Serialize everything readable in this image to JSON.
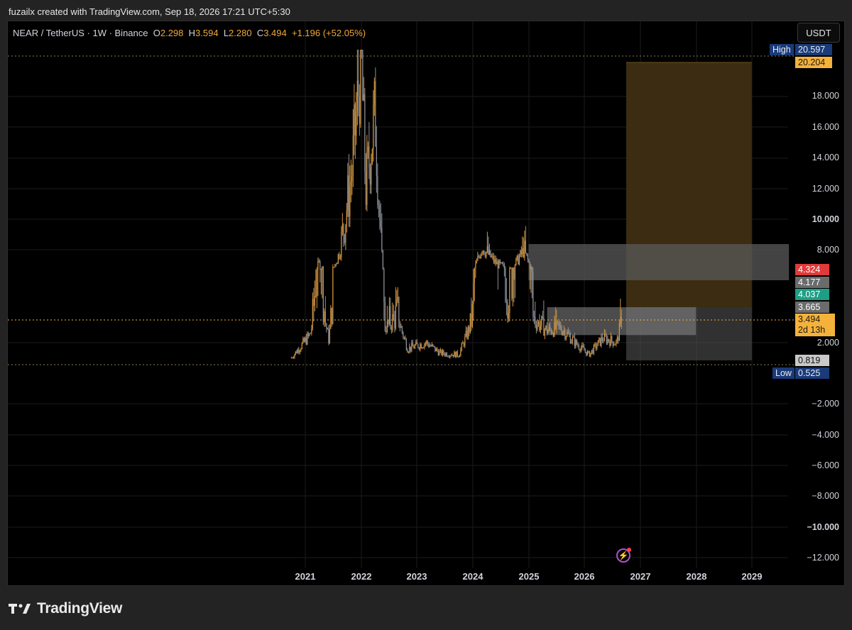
{
  "header": {
    "text": "fuzailx created with TradingView.com, Sep 18, 2026 17:21 UTC+5:30"
  },
  "legend": {
    "symbol": "NEAR / TetherUS · 1W · Binance",
    "open_label": "O",
    "open": "2.298",
    "high_label": "H",
    "high": "3.594",
    "low_label": "L",
    "low": "2.280",
    "close_label": "C",
    "close": "3.494",
    "change": "+1.196 (+52.05%)"
  },
  "currency_button": "USDT",
  "price_tags": {
    "high_label": "High",
    "high_value": "20.597",
    "target": "20.204",
    "t1": "4.324",
    "t2": "4.177",
    "t3": "4.037",
    "t4": "3.665",
    "last": "3.494",
    "countdown": "2d 13h",
    "t5": "0.819",
    "low_label": "Low",
    "low_value": "0.525"
  },
  "colors": {
    "background": "#000000",
    "candle": "#d4953a",
    "candle_alt": "#8c8f98",
    "target_zone": "#3b2c12",
    "grey_zone": "#5a5a5a",
    "accent_yellow": "#f5b23a",
    "tag_blue": "#1a3a78",
    "tag_red": "#e03a3a",
    "tag_green": "#1f9e85",
    "tag_grey": "#6b6b6b"
  },
  "chart_data": {
    "type": "candlestick",
    "title": "NEAR / TetherUS · 1W · Binance",
    "x_ticks": [
      "2021",
      "2022",
      "2023",
      "2024",
      "2025",
      "2026",
      "2027",
      "2028",
      "2029"
    ],
    "y_ticks": [
      "18.000",
      "16.000",
      "14.000",
      "12.000",
      "10.000",
      "8.000",
      "2.000",
      "−2.000",
      "−4.000",
      "−6.000",
      "−8.000",
      "−10.000",
      "−12.000"
    ],
    "y_scale": "log-style price axis",
    "grid": true,
    "approx_close_path": [
      {
        "x": "2020-10",
        "y": 1.0
      },
      {
        "x": "2021-02",
        "y": 2.5
      },
      {
        "x": "2021-04",
        "y": 5.5
      },
      {
        "x": "2021-06",
        "y": 2.2
      },
      {
        "x": "2021-09",
        "y": 9.0
      },
      {
        "x": "2021-11",
        "y": 13.0
      },
      {
        "x": "2022-01",
        "y": 20.5
      },
      {
        "x": "2022-02",
        "y": 12.0
      },
      {
        "x": "2022-04",
        "y": 17.0
      },
      {
        "x": "2022-06",
        "y": 3.0
      },
      {
        "x": "2022-09",
        "y": 3.5
      },
      {
        "x": "2022-11",
        "y": 1.6
      },
      {
        "x": "2023-03",
        "y": 2.0
      },
      {
        "x": "2023-06",
        "y": 1.3
      },
      {
        "x": "2023-10",
        "y": 1.2
      },
      {
        "x": "2024-01",
        "y": 3.5
      },
      {
        "x": "2024-03",
        "y": 8.5
      },
      {
        "x": "2024-06",
        "y": 5.5
      },
      {
        "x": "2024-09",
        "y": 4.0
      },
      {
        "x": "2024-12",
        "y": 7.8
      },
      {
        "x": "2025-02",
        "y": 3.5
      },
      {
        "x": "2025-05",
        "y": 2.8
      },
      {
        "x": "2025-08",
        "y": 3.0
      },
      {
        "x": "2025-11",
        "y": 2.0
      },
      {
        "x": "2026-02",
        "y": 1.2
      },
      {
        "x": "2026-05",
        "y": 2.3
      },
      {
        "x": "2026-08",
        "y": 2.0
      },
      {
        "x": "2026-09",
        "y": 3.494
      }
    ],
    "zones": [
      {
        "name": "target",
        "from_price": 3.665,
        "to_price": 20.204,
        "from_date": "2026-10",
        "to_date": "2029-01"
      },
      {
        "name": "upper-grey",
        "from_price": 4.324,
        "to_price": 8.4,
        "from_date": "2025-01",
        "to_date": "2029-09"
      },
      {
        "name": "lower-grey",
        "from_price": 0.819,
        "to_price": 3.665,
        "from_date": "2026-10",
        "to_date": "2029-01"
      },
      {
        "name": "mid-grey",
        "from_price": 2.5,
        "to_price": 3.665,
        "from_date": "2025-05",
        "to_date": "2028-01"
      }
    ]
  }
}
